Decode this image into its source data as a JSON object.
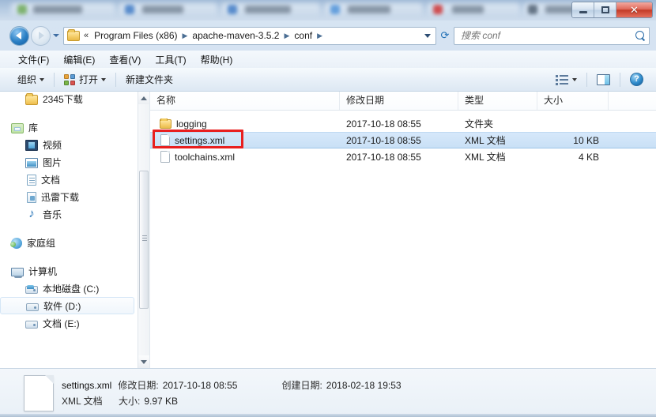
{
  "window": {
    "controls": {
      "minimize": "─",
      "maximize": "❐",
      "close": "✕"
    }
  },
  "address": {
    "back_icon": "back-arrow",
    "forward_icon": "forward-arrow",
    "history_icon": "chevron-down",
    "overflow": "«",
    "crumbs": [
      "Program Files (x86)",
      "apache-maven-3.5.2",
      "conf"
    ],
    "separator": "▶",
    "dropdown_icon": "chevron-down",
    "refresh_icon": "↔",
    "refresh_glyph": "⟳"
  },
  "search": {
    "placeholder": "搜索 conf",
    "value": "",
    "icon": "search-icon"
  },
  "menu": {
    "items": [
      {
        "label": "文件(F)"
      },
      {
        "label": "编辑(E)"
      },
      {
        "label": "查看(V)"
      },
      {
        "label": "工具(T)"
      },
      {
        "label": "帮助(H)"
      }
    ]
  },
  "toolbar": {
    "organize": "组织",
    "open": "打开",
    "new_folder": "新建文件夹",
    "views_icon": "view-options-icon",
    "preview_icon": "preview-pane-icon",
    "help_icon": "help-icon",
    "help_glyph": "?"
  },
  "sidebar": {
    "items": [
      {
        "label": "2345下载",
        "icon": "folder-icon",
        "level": 0,
        "gap_after": true
      },
      {
        "label": "库",
        "icon": "library-icon",
        "level": 0
      },
      {
        "label": "视频",
        "icon": "video-icon",
        "level": 1
      },
      {
        "label": "图片",
        "icon": "picture-icon",
        "level": 1
      },
      {
        "label": "文档",
        "icon": "document-icon",
        "level": 1
      },
      {
        "label": "迅雷下载",
        "icon": "download-icon",
        "level": 1
      },
      {
        "label": "音乐",
        "icon": "music-icon",
        "level": 1,
        "gap_after": true
      },
      {
        "label": "家庭组",
        "icon": "homegroup-icon",
        "level": 0,
        "gap_after": true
      },
      {
        "label": "计算机",
        "icon": "computer-icon",
        "level": 0
      },
      {
        "label": "本地磁盘 (C:)",
        "icon": "system-drive-icon",
        "level": 1
      },
      {
        "label": "软件 (D:)",
        "icon": "drive-icon",
        "level": 1,
        "hovered": true
      },
      {
        "label": "文档 (E:)",
        "icon": "drive-icon",
        "level": 1
      }
    ]
  },
  "filelist": {
    "columns": [
      {
        "key": "name",
        "label": "名称"
      },
      {
        "key": "date",
        "label": "修改日期"
      },
      {
        "key": "type",
        "label": "类型"
      },
      {
        "key": "size",
        "label": "大小"
      }
    ],
    "sort_column": "名称",
    "sort_direction": "ascending",
    "rows": [
      {
        "name": "logging",
        "date": "2017-10-18 08:55",
        "type": "文件夹",
        "size": "",
        "icon": "folder-icon",
        "selected": false
      },
      {
        "name": "settings.xml",
        "date": "2017-10-18 08:55",
        "type": "XML 文档",
        "size": "10 KB",
        "icon": "file-icon",
        "selected": true,
        "highlighted": true
      },
      {
        "name": "toolchains.xml",
        "date": "2017-10-18 08:55",
        "type": "XML 文档",
        "size": "4 KB",
        "icon": "file-icon",
        "selected": false
      }
    ]
  },
  "details": {
    "file_name": "settings.xml",
    "modified_label": "修改日期:",
    "modified_value": "2017-10-18 08:55",
    "created_label": "创建日期:",
    "created_value": "2018-02-18 19:53",
    "file_type": "XML 文档",
    "size_label": "大小:",
    "size_value": "9.97 KB",
    "icon": "file-icon"
  },
  "colors": {
    "accent": "#e81f1f",
    "selection": "#cde2f7",
    "chrome": "#d7e4f2",
    "close_button": "#c33b27"
  }
}
